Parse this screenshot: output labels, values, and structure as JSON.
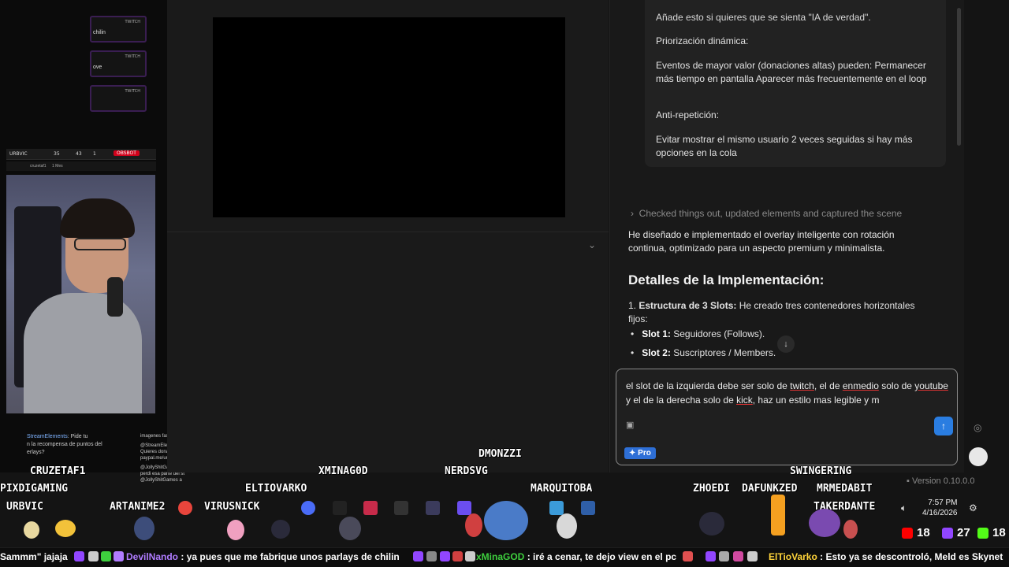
{
  "left_stream": {
    "mini_cards": [
      {
        "platform": "TWITCH",
        "name": "chilin"
      },
      {
        "platform": "TWITCH",
        "name": "ove"
      },
      {
        "platform": "TWITCH",
        "name": ""
      }
    ],
    "cam_bar": {
      "channel": "URBVIC",
      "v1": "35",
      "v2": "43",
      "v3": "1",
      "badge": "OBSBOT"
    },
    "cam_sub": {
      "user": "cruzetaf1",
      "meta": "1 Mes"
    },
    "chat_widget": {
      "left_name": "StreamElements",
      "left_text": ": Pide tu",
      "left_line2": "n la recompensa de puntos del",
      "left_line3": "erlays?",
      "right_lines": [
        "imagenes fas entre c...",
        "@StreamElements",
        "Quieres donar? Sigue",
        "paypal.me/urbvic?cc",
        "@JollyShitGames ja",
        "perdi esa parte del st",
        "@JollyShitGames a"
      ]
    }
  },
  "assistant": {
    "top_text": "Añade esto si quieres que se sienta \"IA de verdad\".",
    "heading1": "Priorización dinámica:",
    "para1": "Eventos de mayor valor (donaciones altas) pueden: Permanecer más tiempo en pantalla Aparecer más frecuentemente en el loop",
    "heading2": "Anti-repetición:",
    "para2": "Evitar mostrar el mismo usuario 2 veces seguidas si hay más opciones en la cola",
    "checked": "Checked things out, updated elements and captured the scene",
    "summary": "He diseñado e implementado el overlay inteligente con rotación continua, optimizado para un aspecto premium y minimalista.",
    "details_title": "Detalles de la Implementación:",
    "item1_num": "1.",
    "item1_bold": "Estructura de 3 Slots:",
    "item1_text": "He creado tres contenedores horizontales fijos:",
    "bullets": [
      {
        "bold": "Slot 1:",
        "text": "Seguidores (Follows)."
      },
      {
        "bold": "Slot 2:",
        "text": "Suscriptores / Members."
      }
    ],
    "input_text_a": "el slot de la izquierda debe ser solo de ",
    "input_twitch": "twitch",
    "input_text_b": ", el de ",
    "input_enmedio": "enmedio",
    "input_text_c": " solo de ",
    "input_youtube": "youtube",
    "input_text_d": " y el de la derecha solo de ",
    "input_kick": "kick",
    "input_text_e": ", haz un estilo  mas legible y m",
    "pro_label": "✦ Pro",
    "version": "Version 0.10.0.0"
  },
  "overlay_names": [
    "DMONZZI",
    "CRUZETAF1",
    "ELTIOVARKO",
    "XMINAG0D",
    "NERDSVG",
    "SWINGERING",
    "PIXDIGAMING",
    "MARQUITOBA",
    "ZHOEDI",
    "DAFUNKZED",
    "MRMEDABIT",
    "URBVIC",
    "ARTANIME2",
    "VIRUSNICK",
    "TAKERDANTE"
  ],
  "clock": {
    "time": "7:57 PM",
    "date": "4/16/2026"
  },
  "stats": [
    {
      "platform": "youtube",
      "value": "18",
      "color": "#ff0000"
    },
    {
      "platform": "twitch",
      "value": "27",
      "color": "#9146ff"
    },
    {
      "platform": "kick",
      "value": "18",
      "color": "#53fc18"
    }
  ],
  "ticker": {
    "t0": "Sammm\" jajaja",
    "t1_user": "DevilNando",
    "t1_msg": ": ya pues que me fabrique unos parlays de chilin",
    "t2_user": "xMinaGOD",
    "t2_msg": ": iré a cenar, te dejo view en el pc",
    "t3_user": "ElTioVarko",
    "t3_msg": ": Esto ya se descontroló, Meld es Skynet"
  },
  "colors": {
    "twitch": "#9146ff",
    "accent": "#2a7de1",
    "kick": "#53fc18"
  }
}
